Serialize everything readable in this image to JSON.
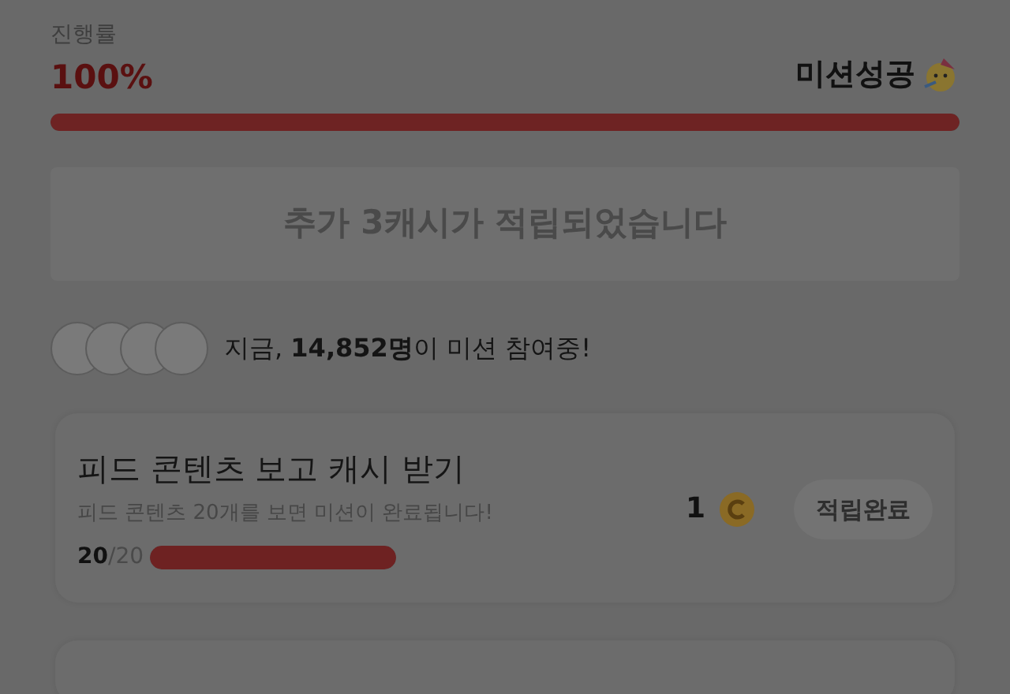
{
  "progress": {
    "label": "진행률",
    "percent": "100%",
    "status": "미션성공",
    "level": 1
  },
  "notice": "추가 3캐시가 적립되었습니다",
  "participants": {
    "text": "지금, **14,852명**이 미션 참여중!"
  },
  "missions": [
    {
      "title": "피드 콘텐츠 보고 캐시 받기",
      "description": "피드 콘텐츠 20개를 보면 미션이 완료됩니다!",
      "count": "20",
      "total": "/20",
      "level": 1,
      "reward": "1",
      "button": "적립완료",
      "completed": true
    }
  ]
}
